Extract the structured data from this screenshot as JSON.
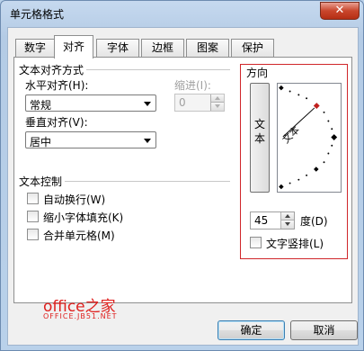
{
  "window": {
    "title": "单元格格式",
    "close_label": "✕"
  },
  "tabs": [
    {
      "label": "数字",
      "active": false
    },
    {
      "label": "对齐",
      "active": true
    },
    {
      "label": "字体",
      "active": false
    },
    {
      "label": "边框",
      "active": false
    },
    {
      "label": "图案",
      "active": false
    },
    {
      "label": "保护",
      "active": false
    }
  ],
  "alignment": {
    "group_label": "文本对齐方式",
    "horizontal_label": "水平对齐(H):",
    "horizontal_value": "常规",
    "vertical_label": "垂直对齐(V):",
    "vertical_value": "居中",
    "indent_label": "缩进(I):",
    "indent_value": "0"
  },
  "text_control": {
    "group_label": "文本控制",
    "wrap_text": {
      "label": "自动换行(W)",
      "checked": false
    },
    "shrink_to_fit": {
      "label": "缩小字体填充(K)",
      "checked": false
    },
    "merge_cells": {
      "label": "合并单元格(M)",
      "checked": false
    }
  },
  "orientation": {
    "group_label": "方向",
    "vertical_text_button": "文本",
    "dial_text": "文本",
    "degrees_value": "45",
    "degrees_label": "度(D)",
    "vertical_stack_label": "文字竖排(L)",
    "vertical_stack_checked": false,
    "highlight_color": "#d0262a"
  },
  "watermark": {
    "title": "office之家",
    "url": "OFFICE.JB51.NET"
  },
  "buttons": {
    "ok": "确定",
    "cancel": "取消"
  },
  "colors": {
    "accent": "#d0262a",
    "title_bar": "#b9d1ea"
  }
}
